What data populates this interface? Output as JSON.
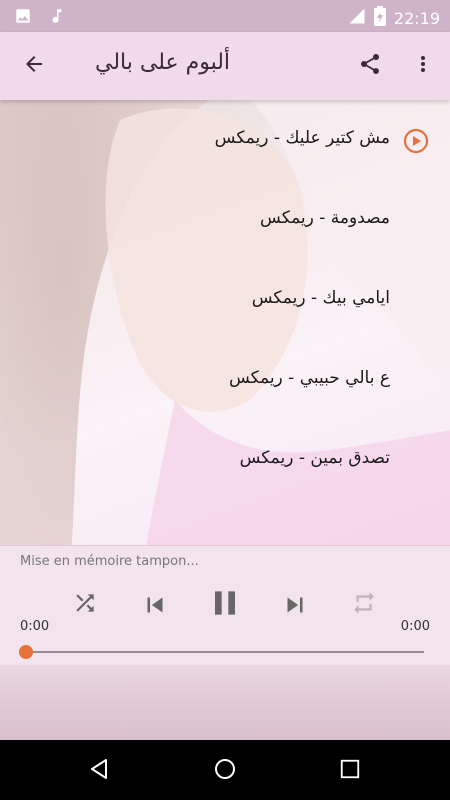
{
  "status_bar": {
    "time": "22:19",
    "left_icons": [
      "image-icon",
      "music-note-icon"
    ],
    "right_icons": [
      "wifi-icon",
      "battery-charging-icon"
    ]
  },
  "app_bar": {
    "title": "ألبوم على بالي",
    "back_icon": "arrow-back-icon",
    "share_icon": "share-icon",
    "menu_icon": "more-vert-icon"
  },
  "tracks": [
    {
      "title": "مش كتير عليك - ريمكس",
      "playing": true
    },
    {
      "title": "مصدومة - ريمكس",
      "playing": false
    },
    {
      "title": "ايامي بيك - ريمكس",
      "playing": false
    },
    {
      "title": "ع بالي حبيبي - ريمكس",
      "playing": false
    },
    {
      "title": "تصدق بمين - ريمكس",
      "playing": false
    }
  ],
  "player": {
    "buffer_text": "Mise en mémoire tampon...",
    "current_time": "0:00",
    "total_time": "0:00",
    "progress": 0,
    "controls": [
      "shuffle-icon",
      "skip-previous-icon",
      "pause-icon",
      "skip-next-icon",
      "repeat-icon"
    ]
  },
  "colors": {
    "app_bar": "#f1dbea",
    "status_bar": "#cfb3c8",
    "accent": "#e8703a"
  }
}
